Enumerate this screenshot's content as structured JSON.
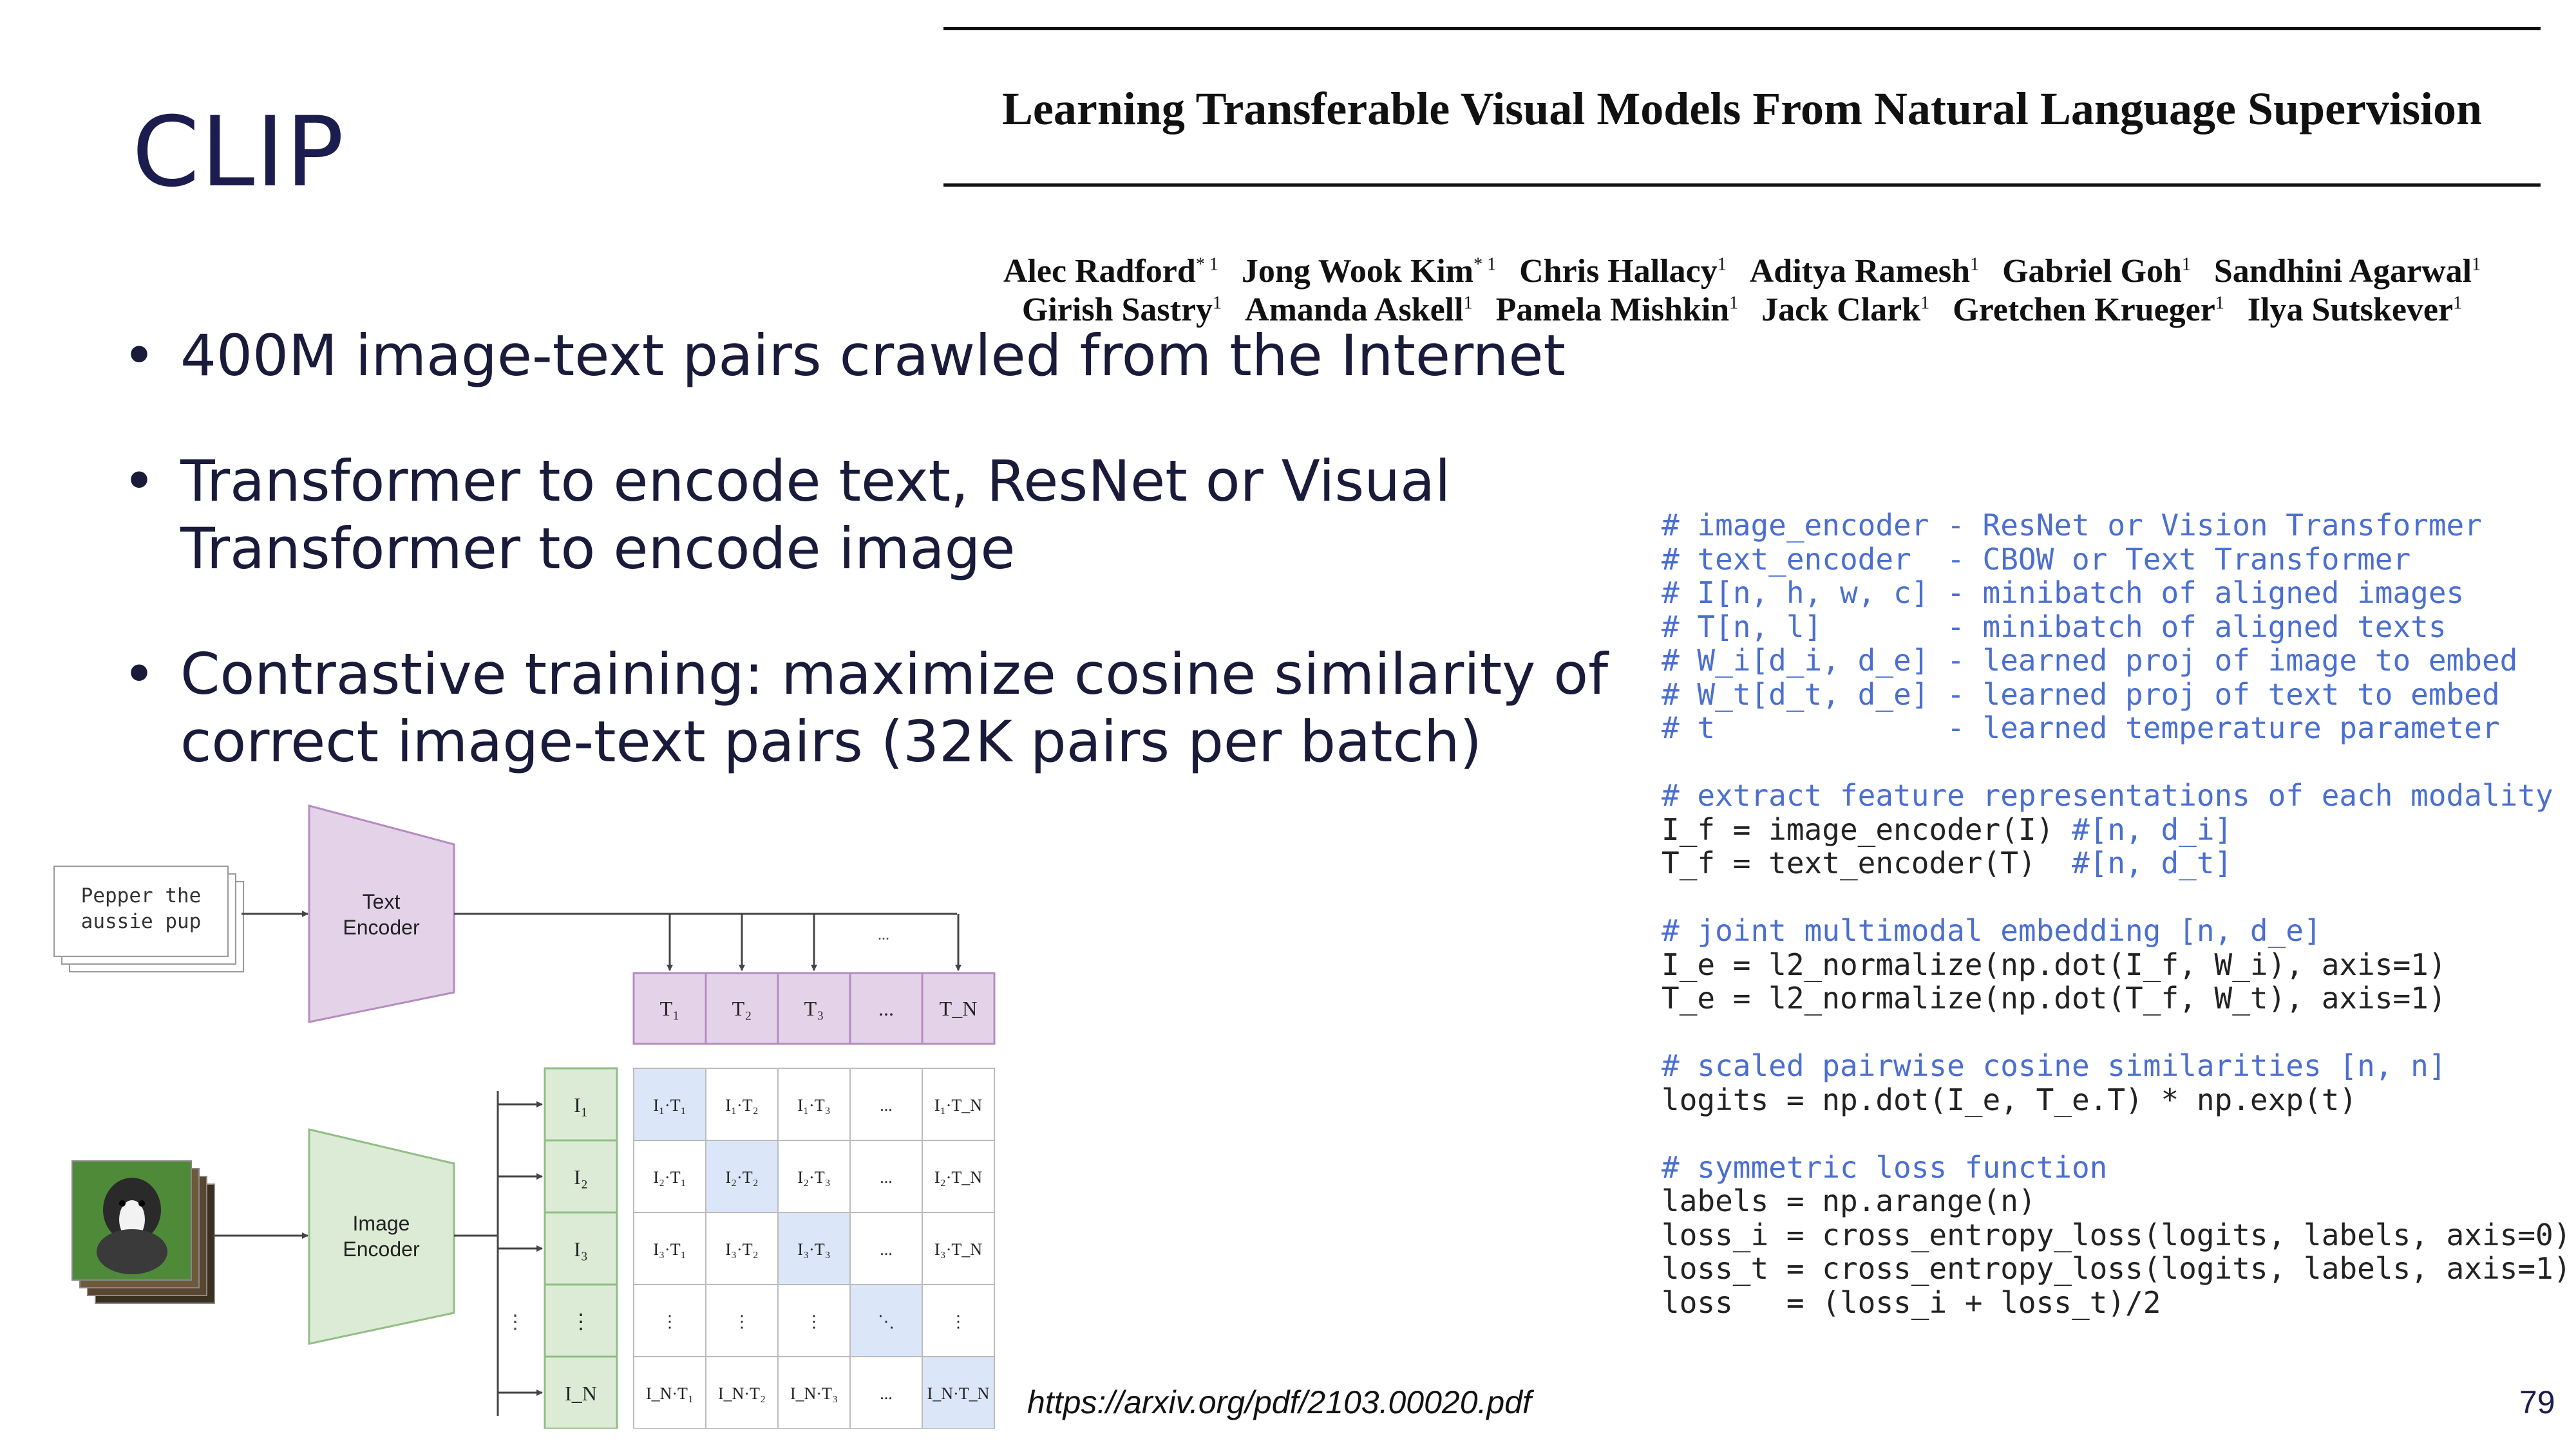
{
  "slide": {
    "title": "CLIP",
    "page_number": "79",
    "source_url": "https://arxiv.org/pdf/2103.00020.pdf"
  },
  "paper": {
    "title": "Learning Transferable Visual Models From Natural Language Supervision",
    "authors_line1": [
      {
        "name": "Alec Radford",
        "sup": "* 1"
      },
      {
        "name": "Jong Wook Kim",
        "sup": "* 1"
      },
      {
        "name": "Chris Hallacy",
        "sup": "1"
      },
      {
        "name": "Aditya Ramesh",
        "sup": "1"
      },
      {
        "name": "Gabriel Goh",
        "sup": "1"
      },
      {
        "name": "Sandhini Agarwal",
        "sup": "1"
      }
    ],
    "authors_line2": [
      {
        "name": "Girish Sastry",
        "sup": "1"
      },
      {
        "name": "Amanda Askell",
        "sup": "1"
      },
      {
        "name": "Pamela Mishkin",
        "sup": "1"
      },
      {
        "name": "Jack Clark",
        "sup": "1"
      },
      {
        "name": "Gretchen Krueger",
        "sup": "1"
      },
      {
        "name": "Ilya Sutskever",
        "sup": "1"
      }
    ]
  },
  "bullets": [
    "400M image-text pairs crawled from the Internet",
    "Transformer to encode text, ResNet or Visual Transformer to encode image",
    "Contrastive training: maximize cosine similarity of correct image-text pairs (32K pairs per batch)"
  ],
  "code": [
    {
      "t": "c",
      "s": "# image_encoder - ResNet or Vision Transformer"
    },
    {
      "t": "c",
      "s": "# text_encoder  - CBOW or Text Transformer"
    },
    {
      "t": "c",
      "s": "# I[n, h, w, c] - minibatch of aligned images"
    },
    {
      "t": "c",
      "s": "# T[n, l]       - minibatch of aligned texts"
    },
    {
      "t": "c",
      "s": "# W_i[d_i, d_e] - learned proj of image to embed"
    },
    {
      "t": "c",
      "s": "# W_t[d_t, d_e] - learned proj of text to embed"
    },
    {
      "t": "c",
      "s": "# t             - learned temperature parameter"
    },
    {
      "t": "b",
      "s": ""
    },
    {
      "t": "c",
      "s": "# extract feature representations of each modality"
    },
    {
      "t": "m",
      "s": "I_f = image_encoder(I)",
      "c": " #[n, d_i]"
    },
    {
      "t": "m",
      "s": "T_f = text_encoder(T) ",
      "c": " #[n, d_t]"
    },
    {
      "t": "b",
      "s": ""
    },
    {
      "t": "c",
      "s": "# joint multimodal embedding [n, d_e]"
    },
    {
      "t": "k",
      "s": "I_e = l2_normalize(np.dot(I_f, W_i), axis=1)"
    },
    {
      "t": "k",
      "s": "T_e = l2_normalize(np.dot(T_f, W_t), axis=1)"
    },
    {
      "t": "b",
      "s": ""
    },
    {
      "t": "c",
      "s": "# scaled pairwise cosine similarities [n, n]"
    },
    {
      "t": "k",
      "s": "logits = np.dot(I_e, T_e.T) * np.exp(t)"
    },
    {
      "t": "b",
      "s": ""
    },
    {
      "t": "c",
      "s": "# symmetric loss function"
    },
    {
      "t": "k",
      "s": "labels = np.arange(n)"
    },
    {
      "t": "k",
      "s": "loss_i = cross_entropy_loss(logits, labels, axis=0)"
    },
    {
      "t": "k",
      "s": "loss_t = cross_entropy_loss(logits, labels, axis=1)"
    },
    {
      "t": "k",
      "s": "loss   = (loss_i + loss_t)/2"
    }
  ],
  "figure": {
    "text_input": [
      "Pepper the",
      "aussie pup"
    ],
    "text_encoder_label": [
      "Text",
      "Encoder"
    ],
    "image_encoder_label": [
      "Image",
      "Encoder"
    ],
    "text_tokens": [
      "T₁",
      "T₂",
      "T₃",
      "...",
      "T_N"
    ],
    "image_tokens": [
      "I₁",
      "I₂",
      "I₃",
      "⋮",
      "I_N"
    ],
    "ellipsis": "...",
    "matrix": [
      [
        "I₁·T₁",
        "I₁·T₂",
        "I₁·T₃",
        "...",
        "I₁·T_N"
      ],
      [
        "I₂·T₁",
        "I₂·T₂",
        "I₂·T₃",
        "...",
        "I₂·T_N"
      ],
      [
        "I₃·T₁",
        "I₃·T₂",
        "I₃·T₃",
        "...",
        "I₃·T_N"
      ],
      [
        "⋮",
        "⋮",
        "⋮",
        "⋱",
        "⋮"
      ],
      [
        "I_N·T₁",
        "I_N·T₂",
        "I_N·T₃",
        "...",
        "I_N·T_N"
      ]
    ],
    "colors": {
      "text_box": "#e4d3e8",
      "text_border": "#b48cc0",
      "image_box": "#dcebd5",
      "image_border": "#92bd85",
      "diag": "#dbe7f8"
    }
  }
}
